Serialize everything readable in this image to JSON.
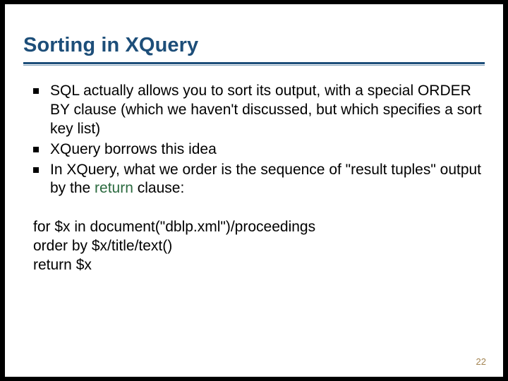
{
  "title": "Sorting in XQuery",
  "bullets": [
    "SQL actually allows you to sort its output, with a special ORDER BY clause (which we haven't discussed, but which specifies a sort key list)",
    "XQuery borrows this idea",
    "In XQuery, what we order is the sequence of \"result tuples\" output by the "
  ],
  "bullet3_highlight": "return",
  "bullet3_tail": " clause:",
  "code": {
    "line1": "for $x in document(\"dblp.xml\")/proceedings",
    "line2": "order by $x/title/text()",
    "line3": "return $x"
  },
  "page_number": "22"
}
